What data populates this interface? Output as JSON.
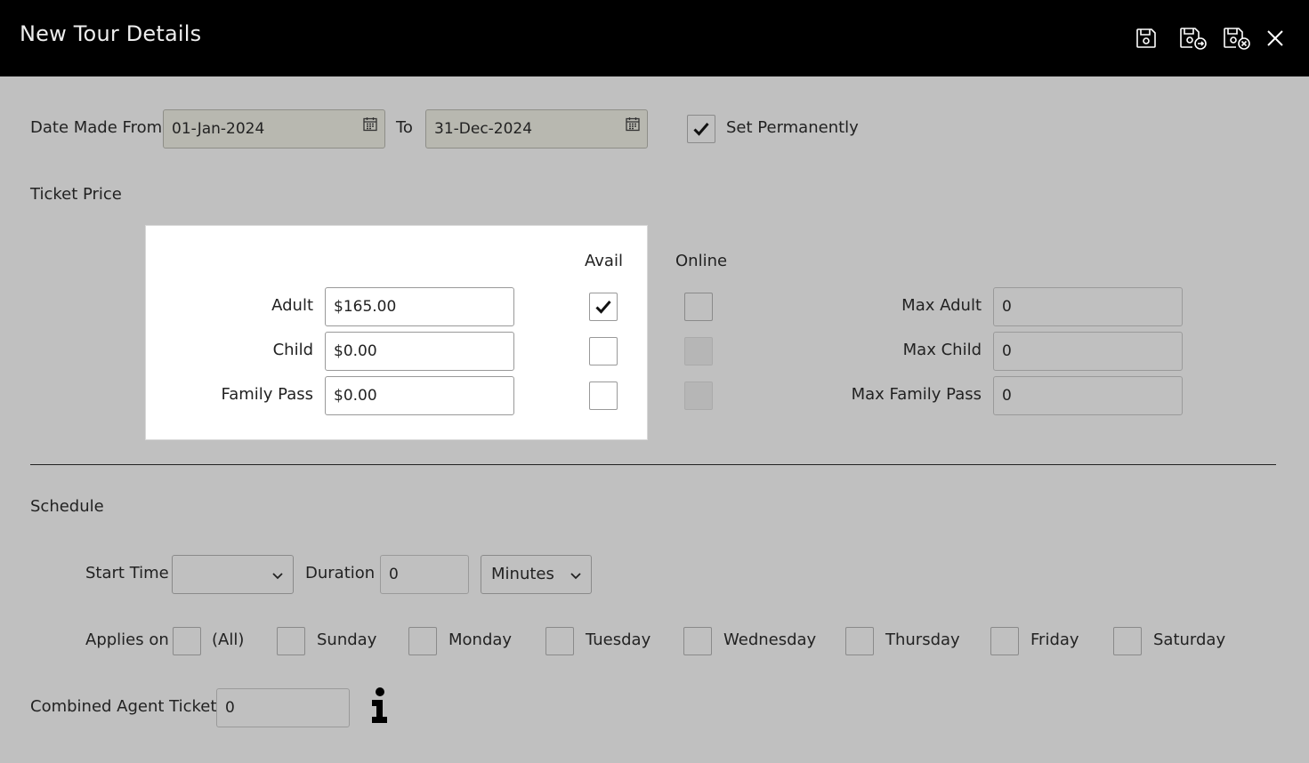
{
  "header": {
    "title": "New Tour Details"
  },
  "date_range": {
    "from_label": "Date Made From",
    "from_value": "01-Jan-2024",
    "to_label": "To",
    "to_value": "31-Dec-2024",
    "set_permanently_label": "Set Permanently",
    "set_permanently_checked": true
  },
  "ticket_price": {
    "section_label": "Ticket Price",
    "avail_header": "Avail",
    "online_header": "Online",
    "rows": [
      {
        "label": "Adult",
        "price": "$165.00",
        "avail": true,
        "online": false,
        "max_label": "Max Adult",
        "max_value": "0"
      },
      {
        "label": "Child",
        "price": "$0.00",
        "avail": false,
        "online": false,
        "max_label": "Max Child",
        "max_value": "0"
      },
      {
        "label": "Family Pass",
        "price": "$0.00",
        "avail": false,
        "online": false,
        "max_label": "Max Family Pass",
        "max_value": "0"
      }
    ]
  },
  "schedule": {
    "section_label": "Schedule",
    "start_time_label": "Start Time",
    "start_time_value": "",
    "duration_label": "Duration",
    "duration_value": "0",
    "duration_unit": "Minutes",
    "applies_on_label": "Applies on",
    "days": [
      "(All)",
      "Sunday",
      "Monday",
      "Tuesday",
      "Wednesday",
      "Thursday",
      "Friday",
      "Saturday"
    ]
  },
  "combined_agent": {
    "label": "Combined Agent Tickets",
    "value": "0"
  },
  "icons": [
    "save-icon",
    "save-new-icon",
    "save-close-icon",
    "close-icon",
    "calendar-icon",
    "checkmark-icon",
    "chevron-down-icon",
    "info-icon"
  ]
}
